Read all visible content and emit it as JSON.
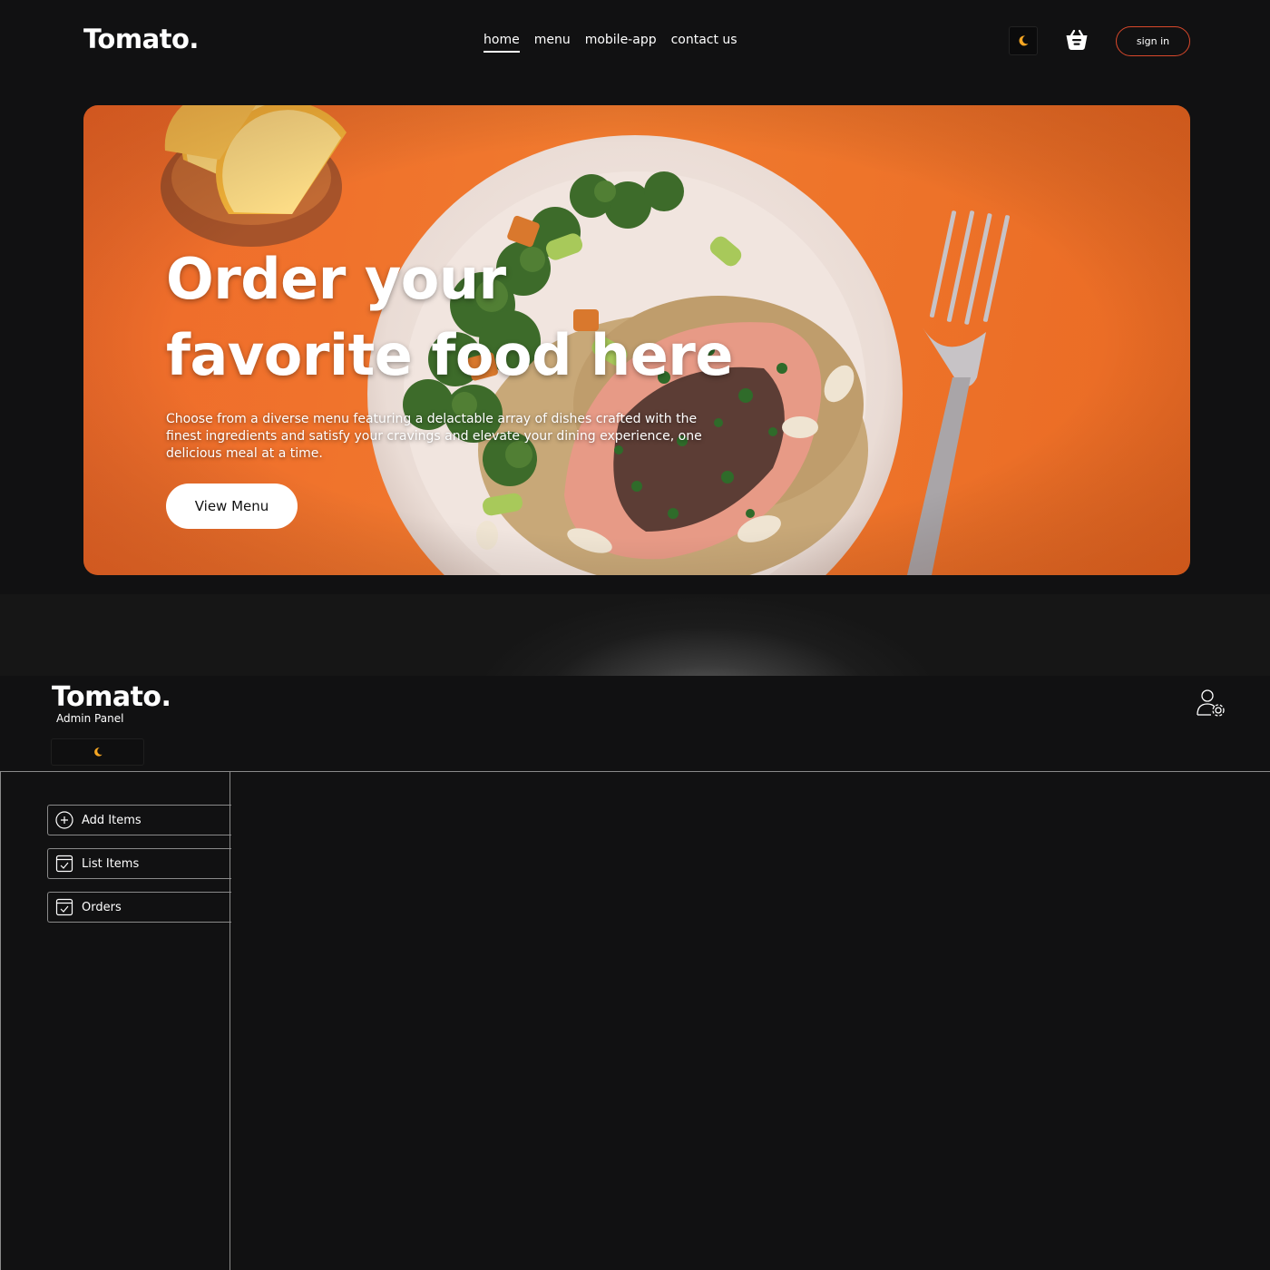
{
  "site": {
    "logo": "Tomato.",
    "nav": [
      {
        "label": "home",
        "active": true
      },
      {
        "label": "menu",
        "active": false
      },
      {
        "label": "mobile-app",
        "active": false
      },
      {
        "label": "contact us",
        "active": false
      }
    ],
    "theme_icon": "moon-icon",
    "basket_icon": "basket-icon",
    "signin_label": "sign in"
  },
  "hero": {
    "title": "Order your favorite food here",
    "description": "Choose from a diverse menu featuring a delactable array of dishes crafted with the finest ingredients and satisfy your cravings and elevate your dining experience, one delicious meal at a time.",
    "button_label": "View Menu"
  },
  "admin": {
    "logo": "Tomato.",
    "subtitle": "Admin Panel",
    "theme_icon": "moon-icon",
    "profile_icon": "user-settings-icon",
    "sidebar": [
      {
        "label": "Add Items",
        "icon": "add-circle-icon"
      },
      {
        "label": "List Items",
        "icon": "checklist-icon"
      },
      {
        "label": "Orders",
        "icon": "checklist-icon"
      }
    ]
  },
  "colors": {
    "background": "#111112",
    "accent": "#d9482b",
    "hero_orange": "#f07a2e",
    "moon": "#f5a623"
  }
}
